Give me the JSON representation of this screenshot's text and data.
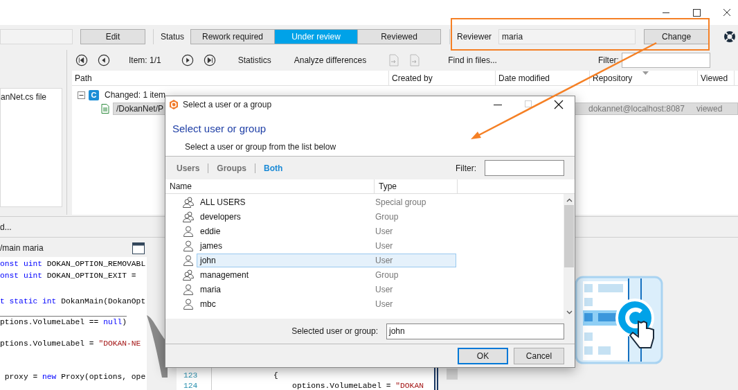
{
  "toolbar": {
    "edit_button": "Edit",
    "status_label": "Status",
    "status_options": [
      {
        "label": "Rework required",
        "selected": false
      },
      {
        "label": "Under review",
        "selected": true
      },
      {
        "label": "Reviewed",
        "selected": false
      }
    ],
    "reviewer_label": "Reviewer",
    "reviewer_value": "maria",
    "change_button": "Change"
  },
  "nav_bar": {
    "item_label": "Item: 1/1",
    "statistics": "Statistics",
    "analyze": "Analyze differences",
    "find": "Find in files...",
    "filter_label": "Filter:"
  },
  "left_panel": {
    "file_label": "anNet.cs file"
  },
  "table": {
    "columns": [
      "Path",
      "Created by",
      "Date modified",
      "Repository",
      "Viewed"
    ],
    "group": {
      "badge": "C",
      "label": "Changed: 1 item",
      "expanded": true
    },
    "rows": [
      {
        "path": "/DokanNet/P",
        "repository": "dokannet@localhost:8087",
        "viewed": "viewed"
      }
    ]
  },
  "bottom": {
    "status_text": "d...",
    "code_header": "/main maria",
    "code_lines": [
      [
        {
          "kind": "keyword",
          "text": "onst uint"
        },
        {
          "kind": "plain",
          "text": " DOKAN_OPTION_REMOVABL"
        }
      ],
      [
        {
          "kind": "keyword",
          "text": "onst uint"
        },
        {
          "kind": "plain",
          "text": " DOKAN_OPTION_EXIT ="
        }
      ],
      [
        {
          "kind": "keyword",
          "text": "t static int"
        },
        {
          "kind": "plain",
          "text": " DokanMain(DokanOpt"
        }
      ],
      [
        {
          "kind": "plain",
          "text": "ptions.VolumeLabel == "
        },
        {
          "kind": "keyword",
          "text": "null"
        },
        {
          "kind": "plain",
          "text": ")"
        }
      ],
      [
        {
          "kind": "plain",
          "text": "ptions.VolumeLabel = "
        },
        {
          "kind": "string",
          "text": "\"DOKAN-NE"
        }
      ],
      [
        {
          "kind": "plain",
          "text": " proxy = "
        },
        {
          "kind": "keyword",
          "text": "new"
        },
        {
          "kind": "plain",
          "text": " Proxy(options, ope"
        }
      ]
    ],
    "line_numbers": [
      "123",
      "124"
    ],
    "lower_code": [
      [
        {
          "kind": "plain",
          "text": "{"
        }
      ],
      [
        {
          "kind": "plain",
          "text": "    options.VolumeLabel = "
        },
        {
          "kind": "string",
          "text": "\"DOKAN"
        }
      ]
    ]
  },
  "dialog": {
    "title": "Select a user or a group",
    "heading": "Select user or group",
    "subtitle": "Select a user or group from the list below",
    "tabs": [
      {
        "label": "Users",
        "selected": false
      },
      {
        "label": "Groups",
        "selected": false
      },
      {
        "label": "Both",
        "selected": true
      }
    ],
    "filter_label": "Filter:",
    "columns": [
      "Name",
      "Type"
    ],
    "rows": [
      {
        "kind": "group",
        "name": "ALL USERS",
        "type": "Special group",
        "selected": false
      },
      {
        "kind": "group",
        "name": "developers",
        "type": "Group",
        "selected": false
      },
      {
        "kind": "user",
        "name": "eddie",
        "type": "User",
        "selected": false
      },
      {
        "kind": "user",
        "name": "james",
        "type": "User",
        "selected": false
      },
      {
        "kind": "user",
        "name": "john",
        "type": "User",
        "selected": true
      },
      {
        "kind": "group",
        "name": "management",
        "type": "Group",
        "selected": false
      },
      {
        "kind": "user",
        "name": "maria",
        "type": "User",
        "selected": false
      },
      {
        "kind": "user",
        "name": "mbc",
        "type": "User",
        "selected": false
      }
    ],
    "selected_label": "Selected user or group:",
    "selected_value": "john",
    "buttons": [
      "OK",
      "Cancel"
    ]
  }
}
